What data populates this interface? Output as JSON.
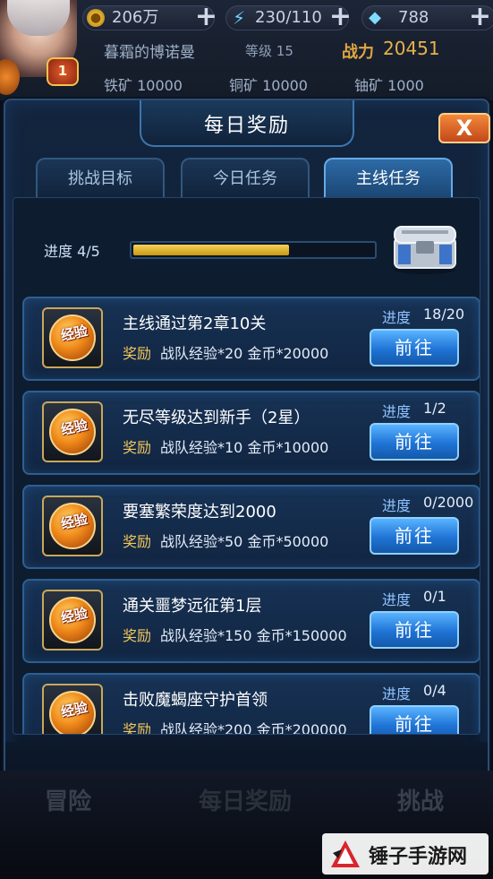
{
  "hud": {
    "gold": "206万",
    "energy": "230/110",
    "gems": "788",
    "nickname": "暮霜的博诺曼",
    "level_label": "等级",
    "level": "15",
    "power_label": "战力",
    "power": "20451",
    "vip": "1",
    "iron_ore": "铁矿 10000",
    "copper_ore": "铜矿 10000",
    "uranium_ore": "铀矿 1000"
  },
  "modal": {
    "title": "每日奖励",
    "close_label": "X",
    "tabs": [
      {
        "label": "挑战目标",
        "active": false
      },
      {
        "label": "今日任务",
        "active": false
      },
      {
        "label": "主线任务",
        "active": true
      }
    ],
    "progress_label": "进度 4/5",
    "progress_fraction": 0.8
  },
  "tasks": [
    {
      "icon": "经验",
      "title": "主线通过第2章10关",
      "reward_label": "奖励",
      "reward": "战队经验*20 金币*20000",
      "progress_label": "进度",
      "progress": "18/20",
      "button": "前往"
    },
    {
      "icon": "经验",
      "title": "无尽等级达到新手（2星）",
      "reward_label": "奖励",
      "reward": "战队经验*10 金币*10000",
      "progress_label": "进度",
      "progress": "1/2",
      "button": "前往"
    },
    {
      "icon": "经验",
      "title": "要塞繁荣度达到2000",
      "reward_label": "奖励",
      "reward": "战队经验*50 金币*50000",
      "progress_label": "进度",
      "progress": "0/2000",
      "button": "前往"
    },
    {
      "icon": "经验",
      "title": "通关噩梦远征第1层",
      "reward_label": "奖励",
      "reward": "战队经验*150 金币*150000",
      "progress_label": "进度",
      "progress": "0/1",
      "button": "前往"
    },
    {
      "icon": "经验",
      "title": "击败魔蝎座守护首领",
      "reward_label": "奖励",
      "reward": "战队经验*200 金币*200000",
      "progress_label": "进度",
      "progress": "0/4",
      "button": "前往"
    }
  ],
  "bottom_nav": [
    "冒险",
    "每日奖励",
    "挑战"
  ],
  "watermark": "锤子手游网"
}
